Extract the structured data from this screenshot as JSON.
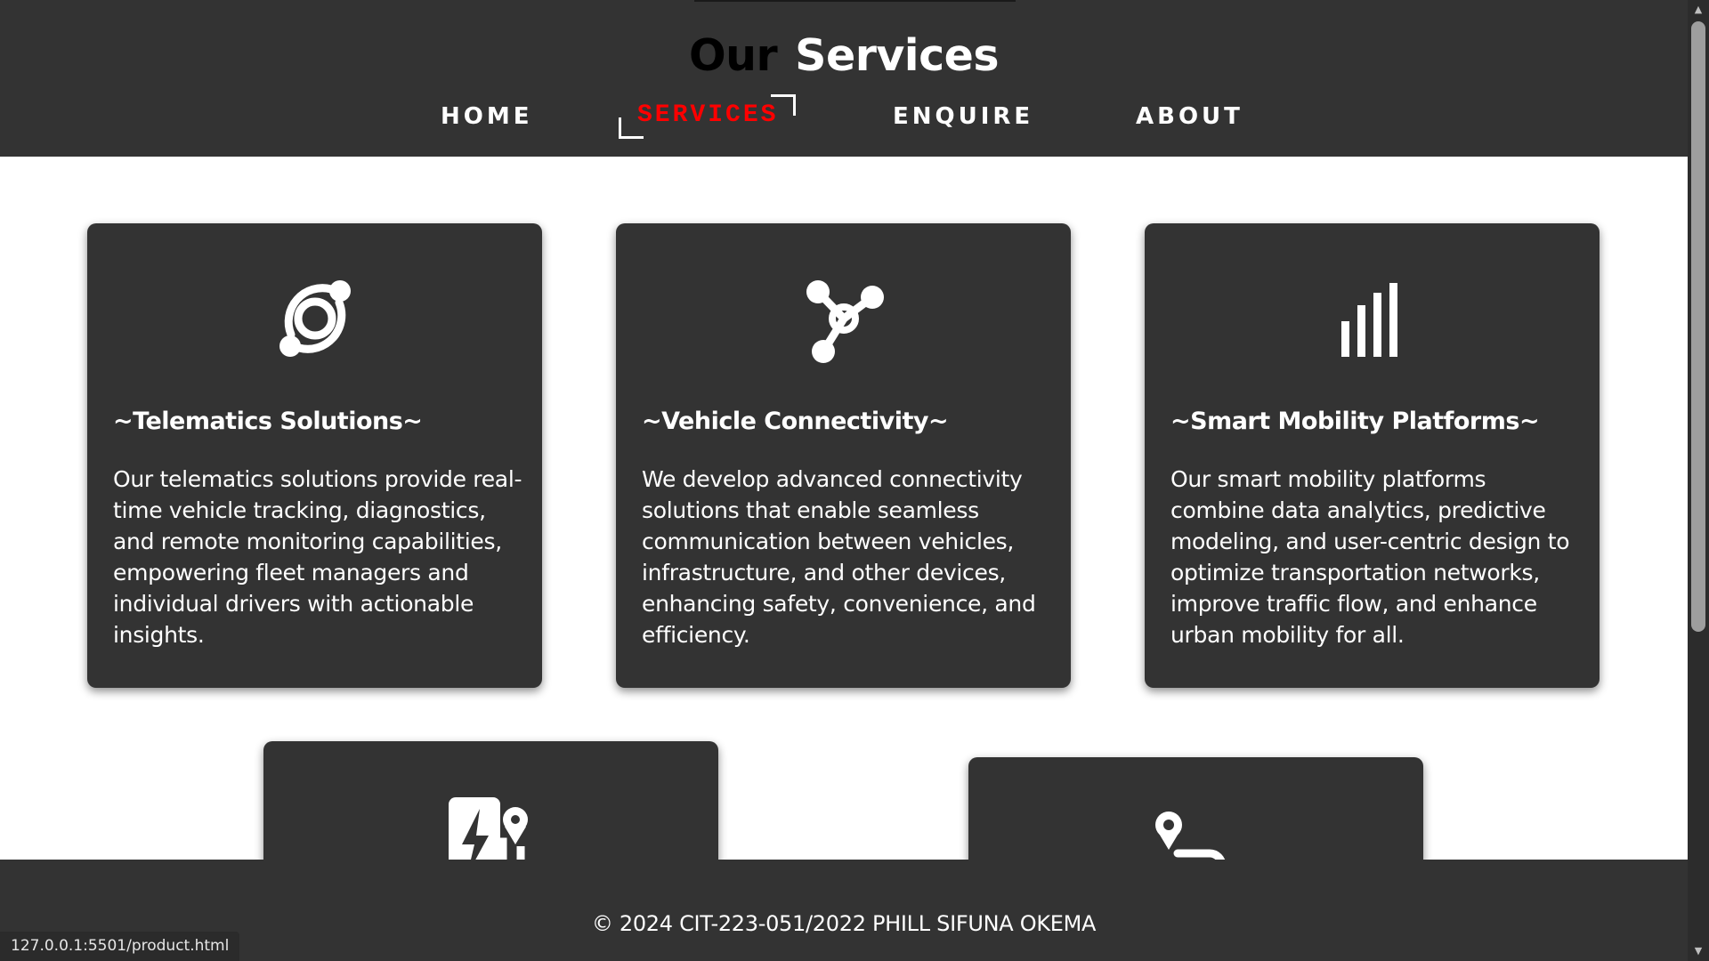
{
  "header": {
    "title_word1": "Our",
    "title_word2": "Services"
  },
  "nav": {
    "items": [
      {
        "label": "HOME",
        "active": false
      },
      {
        "label": "SERVICES",
        "active": true
      },
      {
        "label": "ENQUIRE",
        "active": false
      },
      {
        "label": "ABOUT",
        "active": false
      }
    ]
  },
  "services": [
    {
      "icon": "telematics-orbit-icon",
      "title": "~Telematics Solutions~",
      "description": "Our telematics solutions provide real-time vehicle tracking, diagnostics, and remote monitoring capabilities, empowering fleet managers and individual drivers with actionable insights."
    },
    {
      "icon": "connectivity-hub-icon",
      "title": "~Vehicle Connectivity~",
      "description": "We develop advanced connectivity solutions that enable seamless communication between vehicles, infrastructure, and other devices, enhancing safety, convenience, and efficiency."
    },
    {
      "icon": "signal-bars-icon",
      "title": "~Smart Mobility Platforms~",
      "description": "Our smart mobility platforms combine data analytics, predictive modeling, and user-centric design to optimize transportation networks, improve traffic flow, and enhance urban mobility for all."
    },
    {
      "icon": "ev-charging-icon",
      "title": "",
      "description": ""
    },
    {
      "icon": "route-pin-icon",
      "title": "",
      "description": ""
    }
  ],
  "footer": {
    "copyright": "© 2024  CIT-223-051/2022 PHILL SIFUNA OKEMA"
  },
  "statusbar": {
    "url": "127.0.0.1:5501/product.html"
  },
  "colors": {
    "dark_surface": "#333333",
    "active_nav": "#ff0000",
    "text_light": "#ffffff",
    "title_dark": "#000000"
  }
}
